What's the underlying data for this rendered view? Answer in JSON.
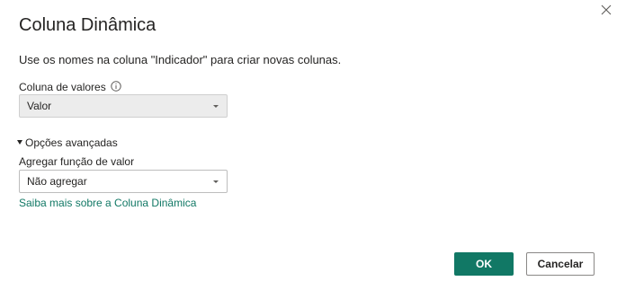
{
  "dialog": {
    "title": "Coluna Dinâmica",
    "description": "Use os nomes na coluna \"Indicador\" para criar novas colunas."
  },
  "icons": {
    "close": "close-icon",
    "info": "info-icon",
    "dropdown": "chevron-down-icon",
    "collapse": "triangle-down-icon"
  },
  "values_column": {
    "label": "Coluna de valores",
    "selected": "Valor"
  },
  "advanced": {
    "toggle_label": "Opções avançadas",
    "aggregate_label": "Agregar função de valor",
    "aggregate_selected": "Não agregar"
  },
  "help_link": "Saiba mais sobre a Coluna Dinâmica",
  "buttons": {
    "ok": "OK",
    "cancel": "Cancelar"
  },
  "colors": {
    "accent": "#117865",
    "text": "#252423",
    "disabled_field": "#ececec"
  }
}
